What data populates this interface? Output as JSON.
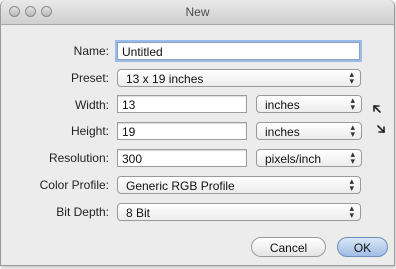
{
  "window": {
    "title": "New"
  },
  "form": {
    "name_label": "Name:",
    "name_value": "Untitled",
    "preset_label": "Preset:",
    "preset_value": "13 x 19 inches",
    "width_label": "Width:",
    "width_value": "13",
    "width_unit": "inches",
    "height_label": "Height:",
    "height_value": "19",
    "height_unit": "inches",
    "resolution_label": "Resolution:",
    "resolution_value": "300",
    "resolution_unit": "pixels/inch",
    "color_profile_label": "Color Profile:",
    "color_profile_value": "Generic RGB Profile",
    "bit_depth_label": "Bit Depth:",
    "bit_depth_value": "8 Bit"
  },
  "buttons": {
    "cancel": "Cancel",
    "ok": "OK"
  },
  "icons": {
    "popup_arrows": "up-down-arrows-icon",
    "aspect_link": "aspect-link-icon"
  }
}
